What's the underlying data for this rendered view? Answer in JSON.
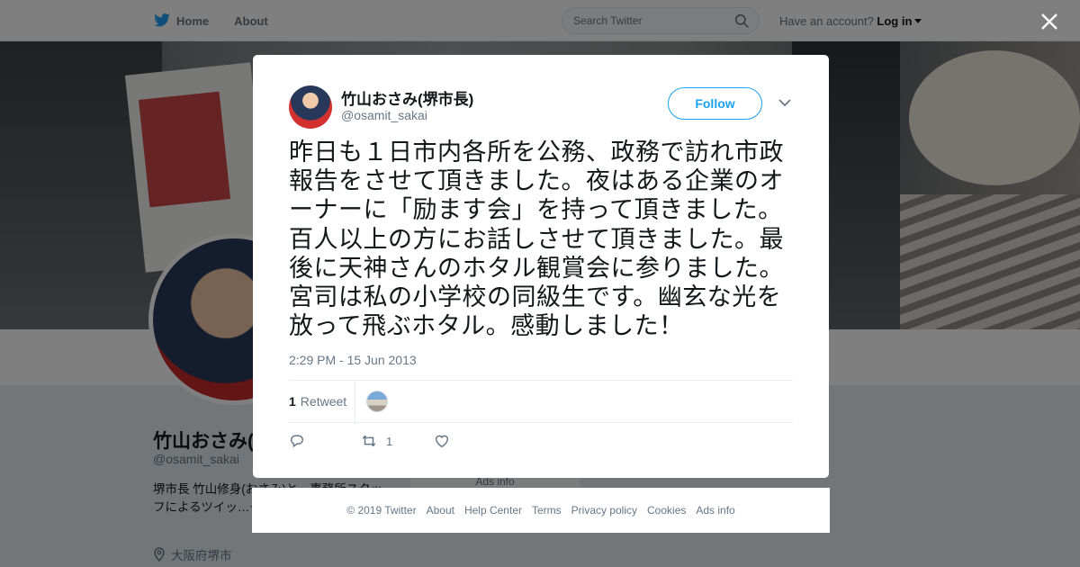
{
  "topbar": {
    "home_label": "Home",
    "about_label": "About",
    "search_placeholder": "Search Twitter",
    "account_prompt": "Have an account?",
    "login_label": "Log in"
  },
  "profile": {
    "name": "竹山おさみ(堺市長)",
    "handle": "@osamit_sakai",
    "bio": "堺市長 竹山修身(おさみ)と、事務所スタッフによるツイッ…ぞよろしくお願い…",
    "location": "大阪府堺市",
    "ads_label": "Ads info"
  },
  "tweet": {
    "author_name": "竹山おさみ(堺市長)",
    "author_handle": "@osamit_sakai",
    "follow_label": "Follow",
    "text": "昨日も１日市内各所を公務、政務で訪れ市政報告をさせて頂きました。夜はある企業のオーナーに「励ます会」を持って頂きました。百人以上の方にお話しさせて頂きました。最後に天神さんのホタル観賞会に参りました。宮司は私の小学校の同級生です。幽玄な光を放って飛ぶホタル。感動しました！",
    "timestamp": "2:29 PM - 15 Jun 2013",
    "retweet_count": "1",
    "retweet_label": "Retweet",
    "action_retweet_count": "1"
  },
  "footer": {
    "links": [
      "© 2019 Twitter",
      "About",
      "Help Center",
      "Terms",
      "Privacy policy",
      "Cookies",
      "Ads info"
    ]
  },
  "colors": {
    "accent": "#1da1f2",
    "text": "#14171a",
    "muted": "#657786"
  }
}
